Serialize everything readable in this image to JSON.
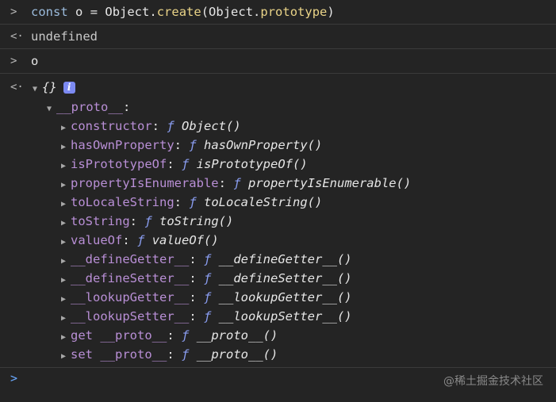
{
  "console": {
    "entries": [
      {
        "kind": "input",
        "prompt_glyph": ">",
        "tokens": {
          "kw": "const",
          "space1": " ",
          "var": "o",
          "eq": " = ",
          "obj1": "Object",
          "dot1": ".",
          "method": "create",
          "paren_open": "(",
          "obj2": "Object",
          "dot2": ".",
          "prop": "prototype",
          "paren_close": ")"
        }
      },
      {
        "kind": "output",
        "prompt_glyph": "<·",
        "text": "undefined"
      },
      {
        "kind": "input",
        "prompt_glyph": ">",
        "text": "o"
      }
    ],
    "object": {
      "prompt_glyph": "<·",
      "expand_glyph": "▼",
      "label": "{}",
      "info_badge": "i",
      "proto": {
        "expand_glyph": "▼",
        "key": "__proto__",
        "colon": ":",
        "items": [
          {
            "key": "constructor",
            "sep": ": ",
            "f": "ƒ",
            "value": "Object()"
          },
          {
            "key": "hasOwnProperty",
            "sep": ": ",
            "f": "ƒ",
            "value": "hasOwnProperty()"
          },
          {
            "key": "isPrototypeOf",
            "sep": ": ",
            "f": "ƒ",
            "value": "isPrototypeOf()"
          },
          {
            "key": "propertyIsEnumerable",
            "sep": ": ",
            "f": "ƒ",
            "value": "propertyIsEnumerable()"
          },
          {
            "key": "toLocaleString",
            "sep": ": ",
            "f": "ƒ",
            "value": "toLocaleString()"
          },
          {
            "key": "toString",
            "sep": ": ",
            "f": "ƒ",
            "value": "toString()"
          },
          {
            "key": "valueOf",
            "sep": ": ",
            "f": "ƒ",
            "value": "valueOf()"
          },
          {
            "key": "__defineGetter__",
            "sep": ": ",
            "f": "ƒ",
            "value": "__defineGetter__()"
          },
          {
            "key": "__defineSetter__",
            "sep": ": ",
            "f": "ƒ",
            "value": "__defineSetter__()"
          },
          {
            "key": "__lookupGetter__",
            "sep": ": ",
            "f": "ƒ",
            "value": "__lookupGetter__()"
          },
          {
            "key": "__lookupSetter__",
            "sep": ": ",
            "f": "ƒ",
            "value": "__lookupSetter__()"
          },
          {
            "key": "get __proto__",
            "sep": ": ",
            "f": "ƒ",
            "value": "__proto__()"
          },
          {
            "key": "set __proto__",
            "sep": ": ",
            "f": "ƒ",
            "value": "__proto__()"
          }
        ],
        "collapsed_glyph": "▶"
      }
    },
    "prompt": {
      "glyph": ">"
    },
    "watermark": "@稀土掘金技术社区"
  },
  "colors": {
    "background": "#242424",
    "keyword": "#9bbbdc",
    "function_name": "#e9d387",
    "property_key": "#b98fd6",
    "f_glyph": "#8a9df0",
    "info_badge": "#7c8af2",
    "prompt_caret": "#6aa9ff"
  }
}
